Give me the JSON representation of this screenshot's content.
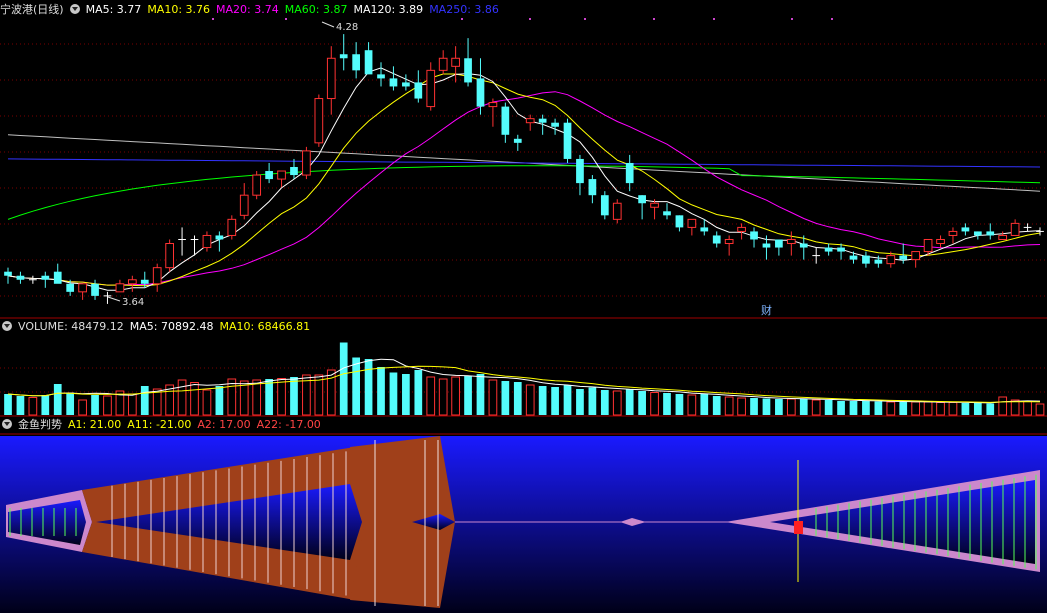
{
  "colors": {
    "up": "#ff3232",
    "down": "#54fcfc",
    "ma5": "#ffffff",
    "ma10": "#ffff00",
    "ma20": "#ff00ff",
    "ma60": "#00ff00",
    "ma120": "#ffffff",
    "ma250": "#3333ff",
    "grid": "#7a0000",
    "panel_border": "#a00000",
    "indicator_bg_top": "#1a1aff",
    "indicator_bg_bottom": "#000018",
    "fish_red": "#a0401a",
    "fish_pink": "#cc88cc",
    "cursor": "#ffff00"
  },
  "price_panel": {
    "title": "宁波港(日线)",
    "legend": [
      {
        "label": "MA5: 3.77",
        "color": "#ffffff"
      },
      {
        "label": "MA10: 3.76",
        "color": "#ffff00"
      },
      {
        "label": "MA20: 3.74",
        "color": "#ff00ff"
      },
      {
        "label": "MA60: 3.87",
        "color": "#00ff00"
      },
      {
        "label": "MA120: 3.89",
        "color": "#ffffff"
      },
      {
        "label": "MA250: 3.86",
        "color": "#3333ff"
      }
    ],
    "high_label": "4.28",
    "low_label": "3.64",
    "fin_badge": "财"
  },
  "volume_panel": {
    "legend": [
      {
        "label": "VOLUME: 48479.12",
        "color": "#dddddd"
      },
      {
        "label": "MA5: 70892.48",
        "color": "#ffffff"
      },
      {
        "label": "MA10: 68466.81",
        "color": "#ffff00"
      }
    ]
  },
  "indicator_panel": {
    "name": "金鱼判势",
    "legend": [
      {
        "label": "A1: 21.00",
        "color": "#ffff00"
      },
      {
        "label": "A11: -21.00",
        "color": "#ffff00"
      },
      {
        "label": "A2: 17.00",
        "color": "#ff4444"
      },
      {
        "label": "A22: -17.00",
        "color": "#ff4444"
      }
    ]
  },
  "chart_data": {
    "type": "candlestick",
    "price_range": [
      3.58,
      4.32
    ],
    "candles": [
      [
        3.69,
        3.7,
        3.66,
        3.68
      ],
      [
        3.68,
        3.69,
        3.66,
        3.67
      ],
      [
        3.67,
        3.68,
        3.66,
        3.67
      ],
      [
        3.68,
        3.69,
        3.65,
        3.67
      ],
      [
        3.69,
        3.71,
        3.67,
        3.66
      ],
      [
        3.66,
        3.67,
        3.63,
        3.64
      ],
      [
        3.64,
        3.66,
        3.62,
        3.66
      ],
      [
        3.66,
        3.67,
        3.62,
        3.63
      ],
      [
        3.63,
        3.64,
        3.61,
        3.63
      ],
      [
        3.64,
        3.67,
        3.64,
        3.66
      ],
      [
        3.66,
        3.68,
        3.64,
        3.67
      ],
      [
        3.67,
        3.69,
        3.65,
        3.66
      ],
      [
        3.66,
        3.71,
        3.64,
        3.7
      ],
      [
        3.7,
        3.77,
        3.69,
        3.76
      ],
      [
        3.77,
        3.8,
        3.73,
        3.77
      ],
      [
        3.77,
        3.78,
        3.73,
        3.77
      ],
      [
        3.75,
        3.79,
        3.74,
        3.78
      ],
      [
        3.78,
        3.79,
        3.74,
        3.77
      ],
      [
        3.78,
        3.83,
        3.77,
        3.82
      ],
      [
        3.83,
        3.91,
        3.82,
        3.88
      ],
      [
        3.88,
        3.94,
        3.87,
        3.93
      ],
      [
        3.94,
        3.96,
        3.91,
        3.92
      ],
      [
        3.92,
        3.94,
        3.9,
        3.94
      ],
      [
        3.95,
        3.97,
        3.92,
        3.93
      ],
      [
        3.93,
        4.0,
        3.92,
        3.99
      ],
      [
        4.01,
        4.13,
        4.0,
        4.12
      ],
      [
        4.12,
        4.25,
        4.08,
        4.22
      ],
      [
        4.23,
        4.28,
        4.19,
        4.22
      ],
      [
        4.23,
        4.26,
        4.17,
        4.19
      ],
      [
        4.24,
        4.26,
        4.2,
        4.18
      ],
      [
        4.18,
        4.21,
        4.15,
        4.17
      ],
      [
        4.17,
        4.2,
        4.14,
        4.15
      ],
      [
        4.16,
        4.18,
        4.14,
        4.15
      ],
      [
        4.16,
        4.19,
        4.11,
        4.12
      ],
      [
        4.1,
        4.21,
        4.09,
        4.19
      ],
      [
        4.19,
        4.24,
        4.18,
        4.22
      ],
      [
        4.2,
        4.25,
        4.16,
        4.22
      ],
      [
        4.22,
        4.27,
        4.15,
        4.16
      ],
      [
        4.17,
        4.22,
        4.08,
        4.1
      ],
      [
        4.1,
        4.12,
        4.05,
        4.11
      ],
      [
        4.1,
        4.11,
        4.01,
        4.03
      ],
      [
        4.02,
        4.03,
        3.99,
        4.01
      ],
      [
        4.06,
        4.08,
        4.04,
        4.07
      ],
      [
        4.07,
        4.08,
        4.03,
        4.06
      ],
      [
        4.06,
        4.07,
        4.03,
        4.05
      ],
      [
        4.06,
        4.07,
        3.96,
        3.97
      ],
      [
        3.97,
        3.98,
        3.88,
        3.91
      ],
      [
        3.92,
        3.93,
        3.86,
        3.88
      ],
      [
        3.88,
        3.89,
        3.82,
        3.83
      ],
      [
        3.82,
        3.87,
        3.81,
        3.86
      ],
      [
        3.96,
        3.98,
        3.89,
        3.91
      ],
      [
        3.88,
        3.88,
        3.82,
        3.86
      ],
      [
        3.85,
        3.87,
        3.82,
        3.86
      ],
      [
        3.84,
        3.86,
        3.82,
        3.83
      ],
      [
        3.83,
        3.83,
        3.79,
        3.8
      ],
      [
        3.8,
        3.82,
        3.78,
        3.82
      ],
      [
        3.8,
        3.82,
        3.78,
        3.79
      ],
      [
        3.78,
        3.79,
        3.75,
        3.76
      ],
      [
        3.76,
        3.78,
        3.73,
        3.77
      ],
      [
        3.79,
        3.81,
        3.77,
        3.8
      ],
      [
        3.79,
        3.8,
        3.75,
        3.77
      ],
      [
        3.76,
        3.78,
        3.72,
        3.75
      ],
      [
        3.77,
        3.77,
        3.73,
        3.75
      ],
      [
        3.76,
        3.79,
        3.73,
        3.77
      ],
      [
        3.76,
        3.78,
        3.72,
        3.75
      ],
      [
        3.73,
        3.75,
        3.71,
        3.73
      ],
      [
        3.75,
        3.76,
        3.73,
        3.74
      ],
      [
        3.75,
        3.76,
        3.72,
        3.74
      ],
      [
        3.73,
        3.74,
        3.71,
        3.72
      ],
      [
        3.73,
        3.74,
        3.7,
        3.71
      ],
      [
        3.72,
        3.73,
        3.7,
        3.71
      ],
      [
        3.71,
        3.74,
        3.7,
        3.73
      ],
      [
        3.73,
        3.76,
        3.71,
        3.72
      ],
      [
        3.72,
        3.74,
        3.7,
        3.74
      ],
      [
        3.74,
        3.77,
        3.73,
        3.77
      ],
      [
        3.76,
        3.78,
        3.75,
        3.77
      ],
      [
        3.78,
        3.8,
        3.76,
        3.79
      ],
      [
        3.8,
        3.81,
        3.78,
        3.79
      ],
      [
        3.79,
        3.79,
        3.77,
        3.78
      ],
      [
        3.79,
        3.81,
        3.77,
        3.78
      ],
      [
        3.77,
        3.79,
        3.77,
        3.78
      ],
      [
        3.78,
        3.82,
        3.78,
        3.81
      ],
      [
        3.8,
        3.81,
        3.79,
        3.8
      ],
      [
        3.79,
        3.8,
        3.78,
        3.79
      ]
    ],
    "volume_range": [
      0,
      150000
    ],
    "volume": [
      42000,
      38000,
      35000,
      40000,
      62000,
      45000,
      30000,
      40000,
      38000,
      48000,
      42000,
      58000,
      52000,
      60000,
      70000,
      65000,
      50000,
      58000,
      72000,
      68000,
      70000,
      72000,
      73000,
      76000,
      80000,
      80000,
      90000,
      145000,
      115000,
      112000,
      96000,
      85000,
      82000,
      90000,
      76000,
      72000,
      76000,
      78000,
      82000,
      70000,
      68000,
      66000,
      60000,
      58000,
      56000,
      60000,
      52000,
      55000,
      50000,
      48000,
      52000,
      48000,
      45000,
      44000,
      42000,
      40000,
      42000,
      38000,
      36000,
      34000,
      34000,
      33000,
      32000,
      32000,
      32000,
      30000,
      30000,
      28000,
      28000,
      28000,
      27000,
      26000,
      26000,
      26000,
      26000,
      25000,
      25000,
      24000,
      24000,
      23000,
      36000,
      30000,
      28000,
      22000
    ],
    "indicator": {
      "A1": 21.0,
      "A11": -21.0,
      "A2": 17.0,
      "A22": -17.0
    }
  }
}
